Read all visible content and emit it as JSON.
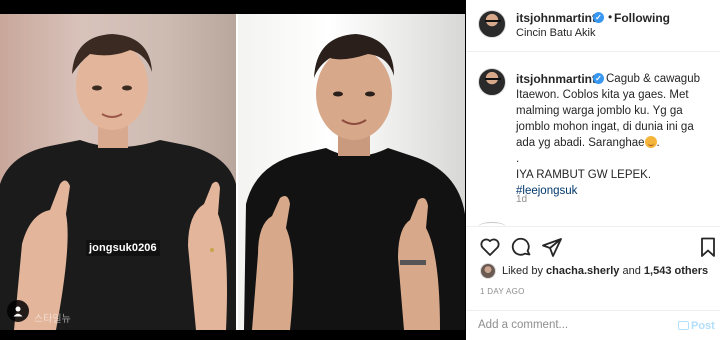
{
  "post": {
    "username": "itsjohnmartint",
    "follow_separator": "•",
    "follow_label": "Following",
    "location": "Cincin Batu Akik",
    "caption": {
      "line1": "Cagub & cawagub",
      "line2": "Itaewon. Coblos kita ya gaes. Met malming warga jomblo ku. Yg ga jomblo mohon ingat, di dunia ini ga ada yg abadi. Saranghae",
      "line2_end": ".",
      "line3": ".",
      "line4": "IYA RAMBUT GW LEPEK.",
      "hashtag": "#leejongsuk"
    },
    "comment_time": "1d",
    "liked_by_prefix": "Liked by",
    "liked_by_user": "chacha.sherly",
    "liked_by_and": "and",
    "liked_by_count": "1,543 others",
    "date": "1 DAY AGO",
    "comment_placeholder": "Add a comment...",
    "post_label": "Post"
  },
  "image": {
    "watermark": "jongsuk0206",
    "corner_logo": "스타일뉴"
  },
  "colors": {
    "verified": "#3897f0",
    "hashtag": "#00376b",
    "post_disabled": "#b2dffc",
    "secondary_text": "#8e8e8e"
  }
}
